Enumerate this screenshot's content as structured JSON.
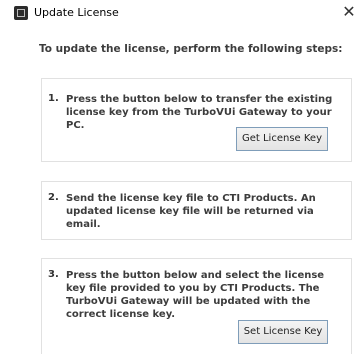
{
  "window": {
    "title": "Update License",
    "close_glyph": "✕",
    "app_icon": "license-app-icon"
  },
  "intro": "To update the license, perform the following steps:",
  "steps": [
    {
      "number": "1.",
      "text": "Press the button below to transfer the existing license key from the TurboVUi Gateway to your PC.",
      "button_label": "Get License Key"
    },
    {
      "number": "2.",
      "text": "Send the license key file to CTI Products. An updated license key file will be returned via email."
    },
    {
      "number": "3.",
      "text": "Press the button below and select the license key file provided to you by CTI Products. The TurboVUi Gateway will be updated with the correct license key.",
      "button_label": "Set License Key"
    }
  ]
}
